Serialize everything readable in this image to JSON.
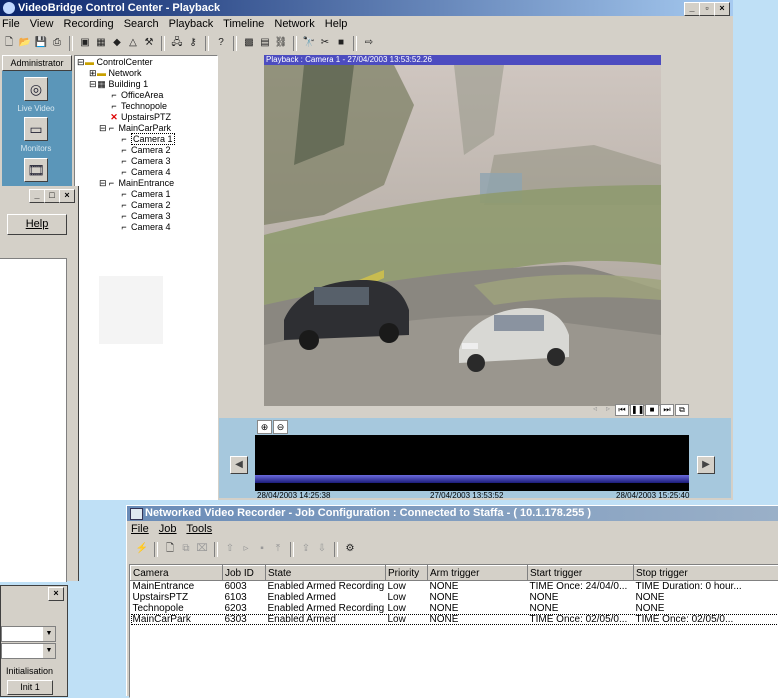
{
  "main_window": {
    "title": "VideoBridge Control Center - Playback",
    "menu": [
      "File",
      "View",
      "Recording",
      "Search",
      "Playback",
      "Timeline",
      "Network",
      "Help"
    ],
    "controls": {
      "minimize": "_",
      "maximize": "т",
      "close": "×"
    }
  },
  "sidebar": {
    "header": "Administrator",
    "items": [
      {
        "label": "Live Video",
        "icon": "camera-icon"
      },
      {
        "label": "Monitors",
        "icon": "monitor-icon"
      },
      {
        "label": "",
        "icon": "film-icon"
      }
    ]
  },
  "tree": {
    "root": "ControlCenter",
    "network": "Network",
    "building": "Building 1",
    "office": "OfficeArea",
    "techno": "Technopole",
    "upstairs": "UpstairsPTZ",
    "maincar": "MainCarPark",
    "mc_cams": [
      "Camera 1",
      "Camera 2",
      "Camera 3",
      "Camera 4"
    ],
    "mainentrance": "MainEntrance",
    "me_cams": [
      "Camera 1",
      "Camera 2",
      "Camera 3",
      "Camera 4"
    ]
  },
  "playback": {
    "header": "Playback : Camera 1 - 27/04/2003 13:53:52.26",
    "timeline": {
      "start": "28/04/2003 14:25:38",
      "mid": "27/04/2003 13:53:52",
      "end": "28/04/2003 15:25:40"
    }
  },
  "back_window": {
    "help_button": "Help",
    "controls": {
      "minimize": "_",
      "maximize": "□",
      "close": "×"
    }
  },
  "small_window": {
    "close": "×",
    "group_label": "Initialisation",
    "init_button": "Init 1"
  },
  "nvr": {
    "title": "Networked Video Recorder - Job Configuration : Connected to Staffa - ( 10.1.178.255 )",
    "menu": [
      "File",
      "Job",
      "Tools"
    ],
    "columns": [
      "Camera",
      "Job ID",
      "State",
      "Priority",
      "Arm trigger",
      "Start trigger",
      "Stop trigger"
    ],
    "rows": [
      [
        "MainEntrance",
        "6003",
        "Enabled Armed Recording",
        "Low",
        "NONE",
        "TIME Once: 24/04/0...",
        "TIME Duration: 0 hour..."
      ],
      [
        "UpstairsPTZ",
        "6103",
        "Enabled Armed",
        "Low",
        "NONE",
        "NONE",
        "NONE"
      ],
      [
        "Technopole",
        "6203",
        "Enabled Armed Recording",
        "Low",
        "NONE",
        "NONE",
        "NONE"
      ],
      [
        "MainCarPark",
        "6303",
        "Enabled Armed",
        "Low",
        "NONE",
        "TIME Once: 02/05/0...",
        "TIME Once: 02/05/0..."
      ]
    ]
  }
}
